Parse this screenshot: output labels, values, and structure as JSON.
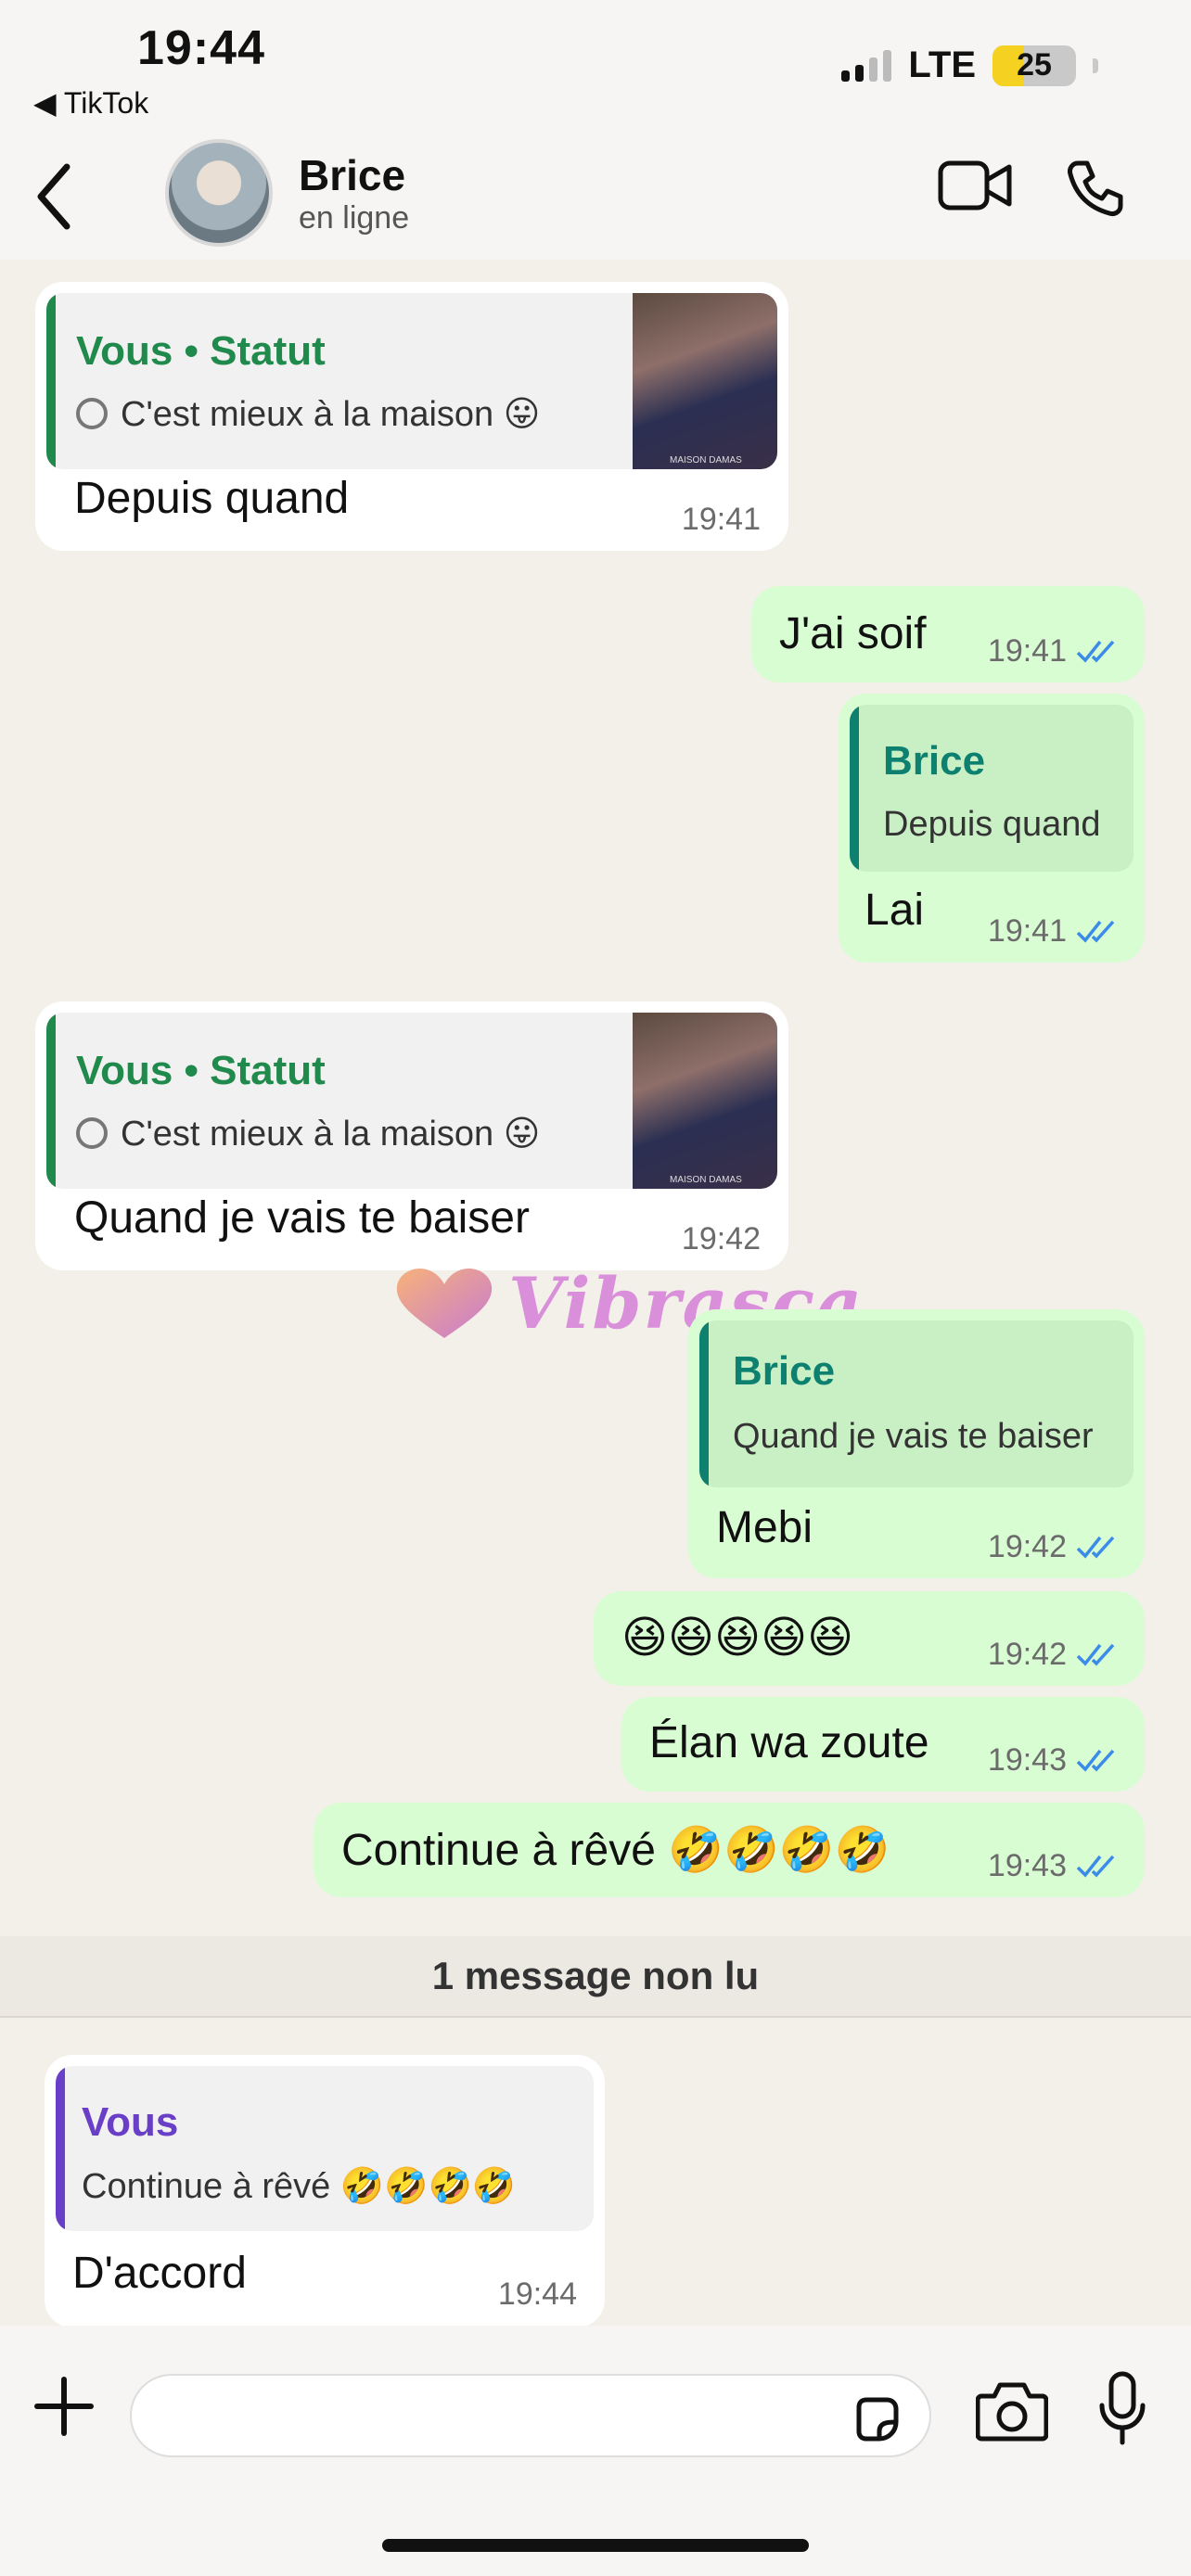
{
  "status_bar": {
    "time": "19:44",
    "back_app": "◀ TikTok",
    "network": "LTE",
    "battery": "25"
  },
  "header": {
    "name": "Brice",
    "status": "en ligne"
  },
  "messages": [
    {
      "quote_name": "Vous • Statut",
      "quote_text": "C'est mieux à la maison 😛",
      "text": "Depuis quand",
      "time": "19:41"
    },
    {
      "text": "J'ai soif",
      "time": "19:41"
    },
    {
      "quote_name": "Brice",
      "quote_text": "Depuis quand",
      "text": "Lai",
      "time": "19:41"
    },
    {
      "quote_name": "Vous • Statut",
      "quote_text": "C'est mieux à la maison 😛",
      "text": "Quand je vais te baiser",
      "time": "19:42"
    },
    {
      "quote_name": "Brice",
      "quote_text": "Quand je vais te baiser",
      "text": "Mebi",
      "time": "19:42"
    },
    {
      "text": "😆😆😆😆😆",
      "time": "19:42"
    },
    {
      "text": "Élan wa zoute",
      "time": "19:43"
    },
    {
      "text": "Continue à rêvé 🤣🤣🤣🤣",
      "time": "19:43"
    },
    {
      "quote_name": "Vous",
      "quote_text": "Continue à rêvé 🤣🤣🤣🤣",
      "text": "D'accord",
      "time": "19:44"
    }
  ],
  "unread_banner": "1 message non lu",
  "thumb_caption": "MAISON DAMAS",
  "watermark": "Vibrasca",
  "colors": {
    "status_quote": "#1f8a4c",
    "brice_quote": "#0e8070",
    "vous_quote": "#6a3fc8",
    "ticks": "#3b8be8"
  }
}
